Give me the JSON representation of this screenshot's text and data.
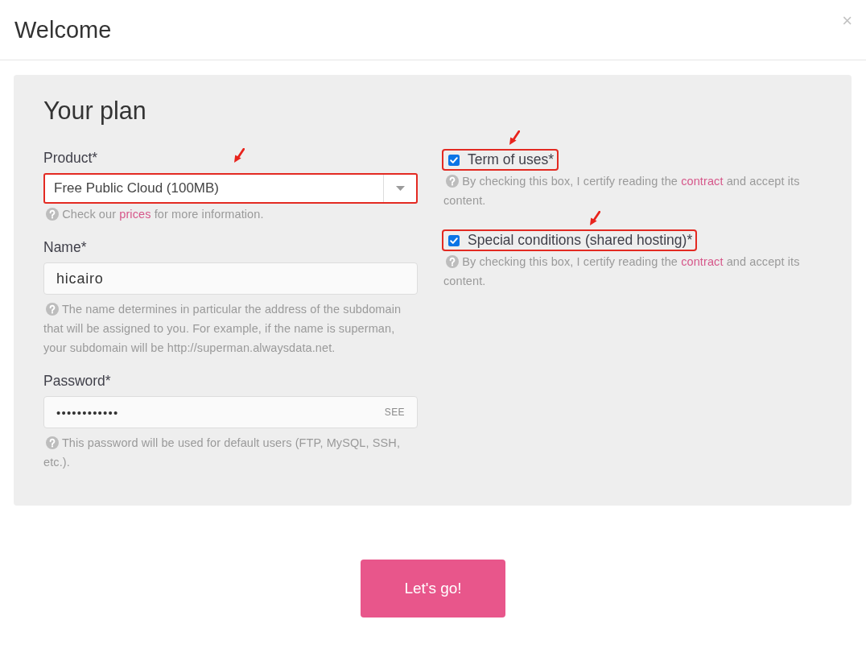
{
  "dialog": {
    "title": "Welcome",
    "close": "×"
  },
  "plan": {
    "title": "Your plan",
    "product": {
      "label": "Product*",
      "value": "Free Public Cloud (100MB)",
      "highlighted": true,
      "help": {
        "before": "Check our",
        "link": "prices",
        "after": "for more information."
      }
    },
    "name": {
      "label": "Name*",
      "value": "hicairo",
      "help": {
        "text": "The name determines in particular the address of the subdomain that will be assigned to you. For example, if the name is superman, your subdomain will be http://superman.alwaysdata.net."
      }
    },
    "password": {
      "label": "Password*",
      "value": "••••••••••••",
      "toggle": "SEE",
      "help": {
        "text": "This password will be used for default users (FTP, MySQL, SSH, etc.)."
      }
    },
    "agreements": [
      {
        "label": "Term of uses*",
        "checked": true,
        "highlighted": true,
        "help": {
          "before": "By checking this box, I certify reading the",
          "link": "contract",
          "after": "and accept its content."
        }
      },
      {
        "label": "Special conditions (shared hosting)*",
        "checked": true,
        "highlighted": true,
        "help": {
          "before": "By checking this box, I certify reading the",
          "link": "contract",
          "after": "and accept its content."
        }
      }
    ]
  },
  "submit": "Let's go!"
}
